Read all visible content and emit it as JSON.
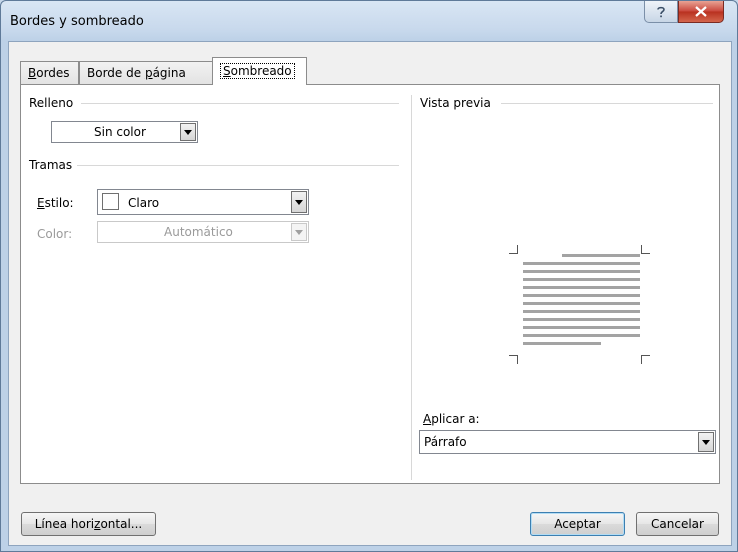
{
  "window": {
    "title": "Bordes y sombreado"
  },
  "tabs": [
    {
      "label_pre": "",
      "label_acc": "B",
      "label_post": "ordes"
    },
    {
      "label_pre": "Borde de ",
      "label_acc": "p",
      "label_post": "ágina"
    },
    {
      "label_pre": "",
      "label_acc": "S",
      "label_post": "ombreado"
    }
  ],
  "relleno": {
    "label": "Relleno",
    "value": "Sin color"
  },
  "tramas": {
    "label": "Tramas",
    "estilo_label_acc": "E",
    "estilo_label_post": "stilo:",
    "estilo_value": "Claro",
    "color_label": "Color:",
    "color_value": "Automático"
  },
  "preview": {
    "label": "Vista previa",
    "apply_label_acc": "A",
    "apply_label_post": "plicar a:",
    "apply_value": "Párrafo"
  },
  "buttons": {
    "horizontal_pre": "Línea hori",
    "horizontal_acc": "z",
    "horizontal_post": "ontal...",
    "accept": "Aceptar",
    "cancel": "Cancelar"
  }
}
